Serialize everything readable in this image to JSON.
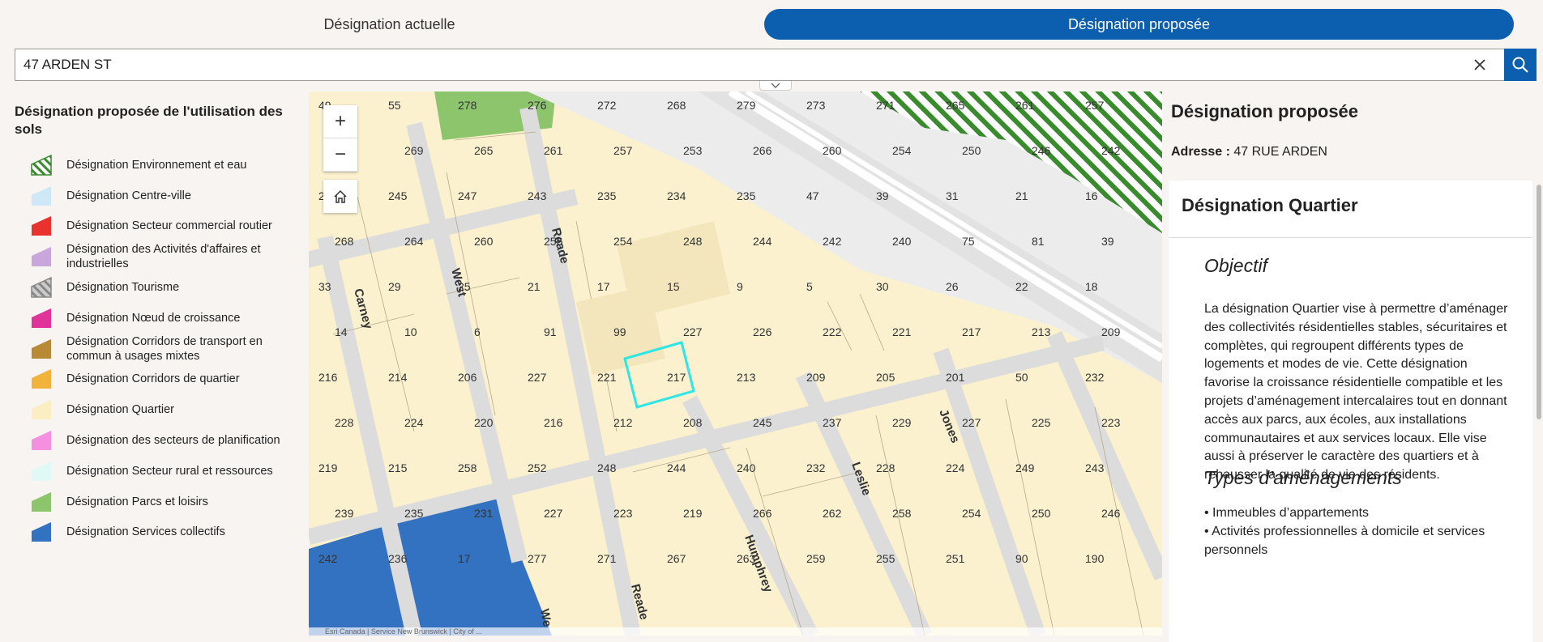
{
  "tabs": [
    {
      "label": "Désignation actuelle",
      "active": false
    },
    {
      "label": "Désignation proposée",
      "active": true
    }
  ],
  "search": {
    "value": "47 ARDEN ST"
  },
  "legend": {
    "title": "Désignation proposée de l'utilisation des sols",
    "items": [
      {
        "label": "Désignation Environnement et eau",
        "color": "#3a8a2e",
        "pattern": "hatch-green"
      },
      {
        "label": "Désignation Centre-ville",
        "color": "#cfe8f7"
      },
      {
        "label": "Désignation Secteur commercial routier",
        "color": "#e8322e"
      },
      {
        "label": "Désignation des Activités d'affaires et industrielles",
        "color": "#c9a6dc"
      },
      {
        "label": "Désignation Tourisme",
        "color": "#888888",
        "pattern": "hatch-grey"
      },
      {
        "label": "Désignation Nœud de croissance",
        "color": "#e0349b"
      },
      {
        "label": "Désignation Corridors de transport en commun à usages mixtes",
        "color": "#b98a36"
      },
      {
        "label": "Désignation Corridors de quartier",
        "color": "#f2b33d"
      },
      {
        "label": "Désignation Quartier",
        "color": "#fbeec2"
      },
      {
        "label": "Désignation des secteurs de planification",
        "color": "#f58fe0"
      },
      {
        "label": "Désignation Secteur rural et ressources",
        "color": "#e0f8f6"
      },
      {
        "label": "Désignation Parcs et loisirs",
        "color": "#8cc56b"
      },
      {
        "label": "Désignation Services collectifs",
        "color": "#3371c1"
      }
    ]
  },
  "map": {
    "streets": [
      "Carney",
      "West",
      "Reade",
      "Reade",
      "Humphrey",
      "Leslie",
      "Jones",
      "We"
    ],
    "lot_numbers": [
      "49",
      "55",
      "278",
      "276",
      "272",
      "268",
      "279",
      "273",
      "271",
      "265",
      "261",
      "257",
      "241",
      "269",
      "265",
      "261",
      "257",
      "253",
      "266",
      "260",
      "254",
      "250",
      "246",
      "242",
      "240",
      "245",
      "247",
      "243",
      "235",
      "234",
      "235",
      "47",
      "39",
      "31",
      "21",
      "16",
      "268",
      "264",
      "260",
      "256",
      "254",
      "248",
      "244",
      "242",
      "240",
      "75",
      "81",
      "39",
      "33",
      "29",
      "25",
      "21",
      "17",
      "15",
      "9",
      "5",
      "30",
      "26",
      "22",
      "18",
      "14",
      "10",
      "6",
      "91",
      "99",
      "227",
      "226",
      "222",
      "221",
      "217",
      "213",
      "209",
      "216",
      "214",
      "206",
      "227",
      "221",
      "217",
      "213",
      "209",
      "205",
      "201",
      "50",
      "232",
      "228",
      "224",
      "220",
      "216",
      "212",
      "208",
      "245",
      "237",
      "229",
      "227",
      "225",
      "223",
      "219",
      "215",
      "258",
      "252",
      "248",
      "244",
      "240",
      "232",
      "228",
      "224",
      "249",
      "243",
      "239",
      "235",
      "231",
      "227",
      "223",
      "219",
      "266",
      "262",
      "258",
      "254",
      "250",
      "246",
      "242",
      "236",
      "17",
      "277",
      "271",
      "267",
      "263",
      "259",
      "255",
      "251",
      "90",
      "190"
    ],
    "highlighted_lot": "47"
  },
  "map_controls": {
    "zoom_in": "+",
    "zoom_out": "−"
  },
  "attribution": "Esri Canada | Service New Brunswick | City of ...",
  "panel": {
    "title": "Désignation proposée",
    "address_label": "Adresse :",
    "address_value": "47 RUE ARDEN",
    "card_title": "Désignation Quartier",
    "objectif_heading": "Objectif",
    "objectif_text": "La désignation Quartier vise à permettre d’aménager des collectivités résidentielles stables, sécuritaires et complètes, qui regroupent différents types de logements et modes de vie. Cette désignation favorise la croissance résidentielle compatible et les projets d’aménagement intercalaires tout en donnant accès aux parcs, aux écoles, aux installations communautaires et aux services locaux. Elle vise aussi à préserver le caractère des quartiers et à rehausser la qualité de vie des résidents.",
    "types_heading": "Types d’aménagements",
    "types": [
      "• Immeubles d’appartements",
      "• Activités professionnelles à domicile et services personnels"
    ]
  }
}
